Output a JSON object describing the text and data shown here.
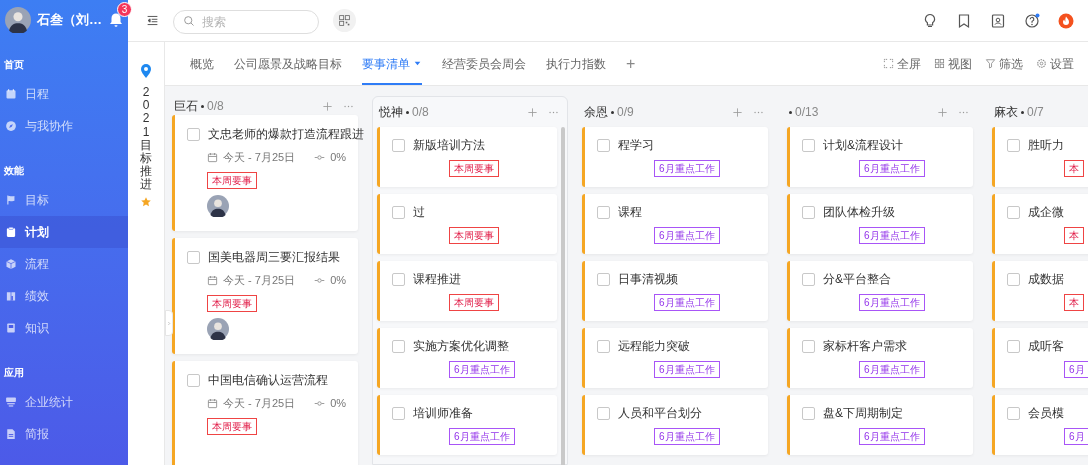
{
  "sidebar": {
    "user": "石叁（刘…",
    "notifications": "3",
    "sections": [
      {
        "title": "首页",
        "items": [
          {
            "label": "日程",
            "selected": false
          },
          {
            "label": "与我协作",
            "selected": false
          }
        ]
      },
      {
        "title": "效能",
        "items": [
          {
            "label": "目标",
            "selected": false
          },
          {
            "label": "计划",
            "selected": true
          },
          {
            "label": "流程",
            "selected": false
          },
          {
            "label": "绩效",
            "selected": false
          },
          {
            "label": "知识",
            "selected": false
          }
        ]
      },
      {
        "title": "应用",
        "items": [
          {
            "label": "企业统计",
            "selected": false
          },
          {
            "label": "简报",
            "selected": false
          }
        ]
      }
    ]
  },
  "topbar": {
    "search": {
      "placeholder": "搜索"
    }
  },
  "project": {
    "title": "2021目标推进"
  },
  "tabs": [
    {
      "label": "概览",
      "selected": false
    },
    {
      "label": "公司愿景及战略目标",
      "selected": false
    },
    {
      "label": "要事清单",
      "selected": true
    },
    {
      "label": "经营委员会周会",
      "selected": false
    },
    {
      "label": "执行力指数",
      "selected": false
    }
  ],
  "add_tab": "+",
  "toolbar": [
    "全屏",
    "视图",
    "筛选",
    "设置"
  ],
  "columns": [
    {
      "name": "巨石",
      "count": "0/8",
      "highlighted": false,
      "cards": [
        {
          "title": "文忠老师的爆款打造流程跟进",
          "checked": false,
          "date": "今天 - 7月25日",
          "progress": "0%",
          "tag": {
            "text": "本周要事",
            "kind": "weekly"
          },
          "avatar": true
        },
        {
          "title": "国美电器周三要汇报结果",
          "checked": false,
          "date": "今天 - 7月25日",
          "progress": "0%",
          "tag": {
            "text": "本周要事",
            "kind": "weekly"
          },
          "avatar": true
        },
        {
          "title": "中国电信确认运营流程",
          "checked": false,
          "date": "今天 - 7月25日",
          "progress": "0%",
          "tag": {
            "text": "本周要事",
            "kind": "weekly"
          },
          "avatar": false
        }
      ]
    },
    {
      "name": "悦神",
      "count": "0/8",
      "highlighted": true,
      "cards": [
        {
          "title": "新版培训方法",
          "checked": false,
          "tag": {
            "text": "本周要事",
            "kind": "weekly"
          }
        },
        {
          "title": "过",
          "checked": false,
          "tag": {
            "text": "本周要事",
            "kind": "weekly"
          }
        },
        {
          "title": "课程推进",
          "checked": false,
          "tag": {
            "text": "本周要事",
            "kind": "weekly"
          }
        },
        {
          "title": "实施方案优化调整",
          "checked": false,
          "tag": {
            "text": "6月重点工作",
            "kind": "monthly"
          }
        },
        {
          "title": "培训师准备",
          "checked": false,
          "tag": {
            "text": "6月重点工作",
            "kind": "monthly"
          }
        }
      ]
    },
    {
      "name": "余恩",
      "count": "0/9",
      "highlighted": false,
      "cards": [
        {
          "title": "程学习",
          "checked": false,
          "tag": {
            "text": "6月重点工作",
            "kind": "monthly"
          }
        },
        {
          "title": "课程",
          "checked": false,
          "tag": {
            "text": "6月重点工作",
            "kind": "monthly"
          }
        },
        {
          "title": "日事清视频",
          "checked": false,
          "tag": {
            "text": "6月重点工作",
            "kind": "monthly"
          }
        },
        {
          "title": "远程能力突破",
          "checked": false,
          "tag": {
            "text": "6月重点工作",
            "kind": "monthly"
          }
        },
        {
          "title": "人员和平台划分",
          "checked": false,
          "tag": {
            "text": "6月重点工作",
            "kind": "monthly"
          }
        }
      ]
    },
    {
      "count": "0/13",
      "highlighted": false,
      "cards": [
        {
          "title": "计划&流程设计",
          "checked": false,
          "tag": {
            "text": "6月重点工作",
            "kind": "monthly"
          }
        },
        {
          "title": "团队体检升级",
          "checked": false,
          "tag": {
            "text": "6月重点工作",
            "kind": "monthly"
          }
        },
        {
          "title": "分&平台整合",
          "checked": false,
          "tag": {
            "text": "6月重点工作",
            "kind": "monthly"
          }
        },
        {
          "title": "家标杆客户需求",
          "checked": false,
          "tag": {
            "text": "6月重点工作",
            "kind": "monthly"
          }
        },
        {
          "title": "盘&下周期制定",
          "checked": false,
          "tag": {
            "text": "6月重点工作",
            "kind": "monthly"
          }
        }
      ]
    },
    {
      "name": "麻衣",
      "count": "0/7",
      "highlighted": false,
      "cards": [
        {
          "title": "胜听力",
          "checked": false,
          "tag": {
            "text": "本",
            "kind": "weekly"
          }
        },
        {
          "title": "成企微",
          "checked": false,
          "tag": {
            "text": "本",
            "kind": "weekly"
          }
        },
        {
          "title": "成数据",
          "checked": false,
          "tag": {
            "text": "本",
            "kind": "weekly"
          }
        },
        {
          "title": "成听客",
          "checked": false,
          "tag": {
            "text": "6月",
            "kind": "monthly"
          }
        },
        {
          "title": "会员模",
          "checked": false,
          "tag": {
            "text": "6月",
            "kind": "monthly"
          }
        }
      ]
    }
  ]
}
